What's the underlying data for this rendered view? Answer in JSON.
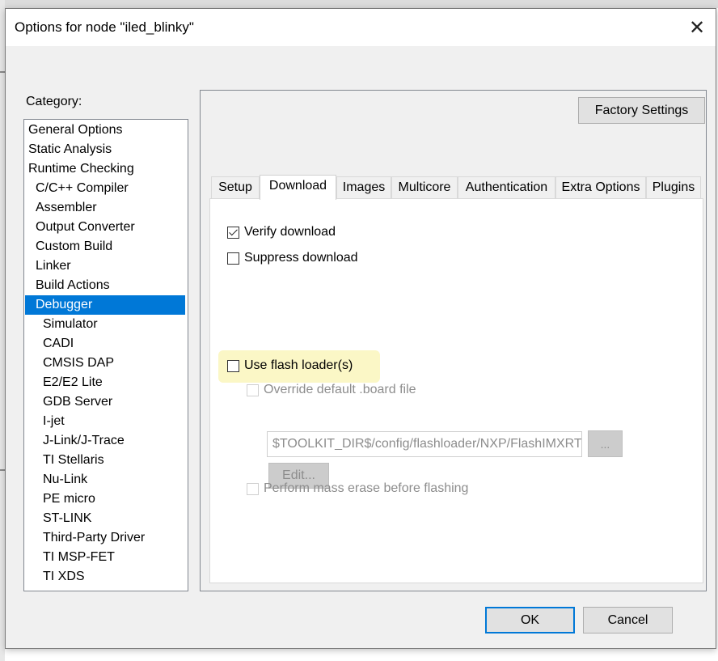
{
  "dialog": {
    "title": "Options for node \"iled_blinky\"",
    "close_icon": "close-icon"
  },
  "category": {
    "label": "Category:",
    "selected": "Debugger",
    "items": [
      "General Options",
      "Static Analysis",
      "Runtime Checking",
      "C/C++ Compiler",
      "Assembler",
      "Output Converter",
      "Custom Build",
      "Linker",
      "Build Actions",
      "Debugger",
      "Simulator",
      "CADI",
      "CMSIS DAP",
      "E2/E2 Lite",
      "GDB Server",
      "I-jet",
      "J-Link/J-Trace",
      "TI Stellaris",
      "Nu-Link",
      "PE micro",
      "ST-LINK",
      "Third-Party Driver",
      "TI MSP-FET",
      "TI XDS"
    ]
  },
  "factory_settings_label": "Factory Settings",
  "tabs": {
    "active": "Download",
    "items": [
      "Setup",
      "Download",
      "Images",
      "Multicore",
      "Authentication",
      "Extra Options",
      "Plugins"
    ]
  },
  "download": {
    "verify_download": {
      "label": "Verify download",
      "checked": true
    },
    "suppress_download": {
      "label": "Suppress download",
      "checked": false
    },
    "use_flash_loader": {
      "label": "Use flash loader(s)",
      "checked": false,
      "highlight_color": "#fbf7c6"
    },
    "override_board_file": {
      "label": "Override default .board file",
      "checked": false,
      "enabled": false
    },
    "board_file_path": "$TOOLKIT_DIR$/config/flashloader/NXP/FlashIMXRT",
    "browse_label": "...",
    "edit_label": "Edit...",
    "mass_erase": {
      "label": "Perform mass erase before flashing",
      "checked": false,
      "enabled": false
    }
  },
  "buttons": {
    "ok": "OK",
    "cancel": "Cancel"
  },
  "colors": {
    "selection": "#0078d7",
    "dialog_bg": "#f0f0f0",
    "default_button_border": "#0078d7"
  }
}
